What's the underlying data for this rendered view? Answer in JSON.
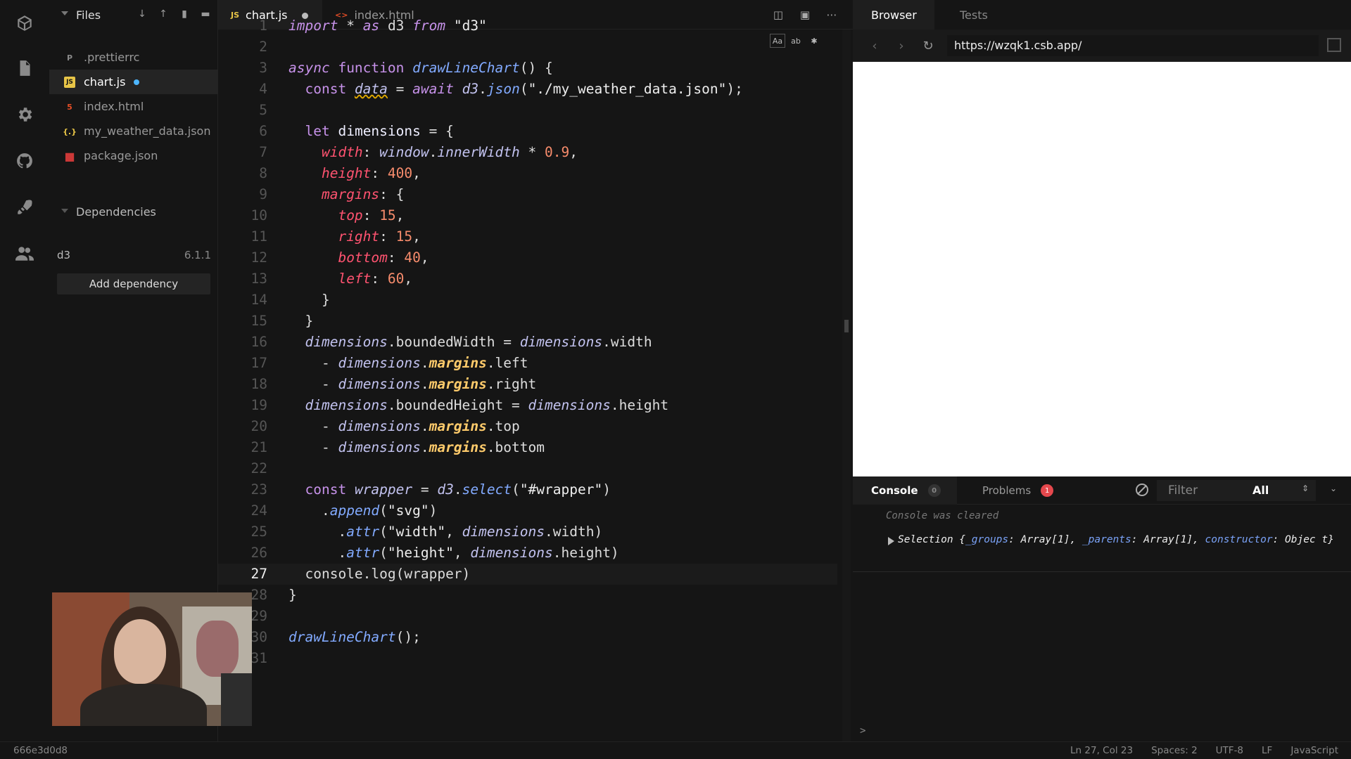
{
  "sidebar": {
    "files_title": "Files",
    "files": [
      {
        "name": ".prettierrc",
        "icon": "P",
        "icon_color": "#8a8a8a"
      },
      {
        "name": "chart.js",
        "icon": "JS",
        "icon_color": "#e8c547"
      },
      {
        "name": "index.html",
        "icon": "5",
        "icon_color": "#e44d26"
      },
      {
        "name": "my_weather_data.json",
        "icon": "{.}",
        "icon_color": "#e8c547"
      },
      {
        "name": "package.json",
        "icon": "■",
        "icon_color": "#cb3837"
      }
    ],
    "dependencies_title": "Dependencies",
    "dependency": {
      "name": "d3",
      "version": "6.1.1"
    },
    "add_dependency_label": "Add dependency"
  },
  "editor": {
    "tabs": [
      {
        "label": "chart.js",
        "icon": "JS"
      },
      {
        "label": "index.html",
        "icon": "<>"
      }
    ],
    "find_widget": [
      "Aa",
      "ab",
      "✱"
    ],
    "current_line": 27
  },
  "browser": {
    "tabs": [
      "Browser",
      "Tests"
    ],
    "url": "https://wzqk1.csb.app/"
  },
  "console": {
    "tab_console": "Console",
    "console_count": "0",
    "tab_problems": "Problems",
    "problems_count": "1",
    "filter_placeholder": "Filter",
    "level": "All",
    "cleared_message": "Console was cleared",
    "log": {
      "prefix": "Selection {",
      "k1": "_groups",
      "v1": ": Array[1], ",
      "k2": "_parents",
      "v2": ": Array[1], ",
      "k3": "constructor",
      "v3": ": Objec t}"
    },
    "prompt": ">"
  },
  "statusbar": {
    "sha": "666e3d0d8",
    "position": "Ln 27, Col 23",
    "spaces": "Spaces: 2",
    "encoding": "UTF-8",
    "eol": "LF",
    "language": "JavaScript"
  }
}
